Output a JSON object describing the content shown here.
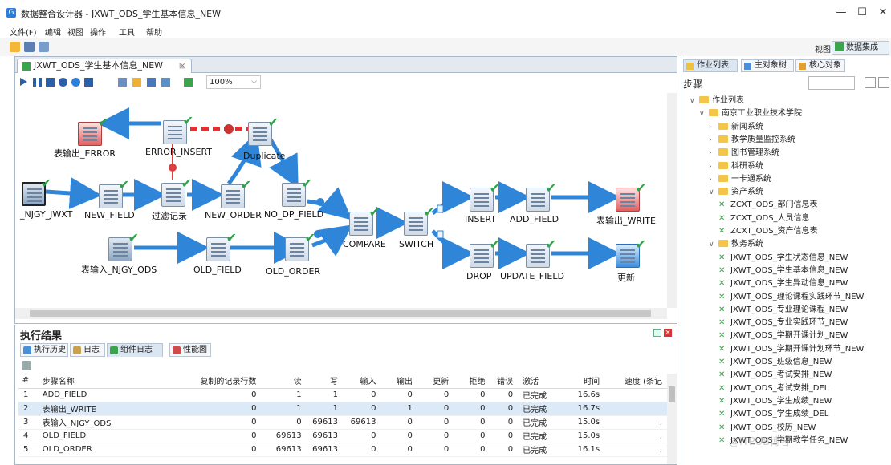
{
  "window": {
    "title": "数据整合设计器 - JXWT_ODS_学生基本信息_NEW",
    "minimize": "—",
    "maximize": "☐",
    "close": "✕"
  },
  "menu": [
    "文件(F)",
    "编辑",
    "视图",
    "操作",
    "工具",
    "帮助"
  ],
  "toolbar": {
    "view_label": "视图:",
    "view_button": "数据集成"
  },
  "editor": {
    "tab_label": "JXWT_ODS_学生基本信息_NEW",
    "tab_close": "⊠",
    "zoom": "100%",
    "nodes": {
      "error_out": "表输出_ERROR",
      "error_insert": "ERROR_INSERT",
      "duplicate": "Duplicate",
      "njgy_jwxt": "_NJGY_JWXT",
      "new_field": "NEW_FIELD",
      "filter": "过滤记录",
      "new_order": "NEW_ORDER",
      "no_dp_field": "NO_DP_FIELD",
      "compare": "COMPARE",
      "switch": "SWITCH",
      "insert": "INSERT",
      "add_field": "ADD_FIELD",
      "write_out": "表输出_WRITE",
      "njgy_ods": "表输入_NJGY_ODS",
      "old_field": "OLD_FIELD",
      "old_order": "OLD_ORDER",
      "drop": "DROP",
      "update_field": "UPDATE_FIELD",
      "update": "更新"
    }
  },
  "results": {
    "title": "执行结果",
    "tabs": [
      "执行历史",
      "日志",
      "组件日志",
      "性能图"
    ],
    "columns": [
      "#",
      "步骤名称",
      "复制的记录行数",
      "读",
      "写",
      "输入",
      "输出",
      "更新",
      "拒绝",
      "错误",
      "激活",
      "时间",
      "速度 (条记"
    ],
    "rows": [
      [
        "1",
        "ADD_FIELD",
        "0",
        "1",
        "1",
        "0",
        "0",
        "0",
        "0",
        "0",
        "已完成",
        "16.6s",
        ""
      ],
      [
        "2",
        "表输出_WRITE",
        "0",
        "1",
        "1",
        "0",
        "1",
        "0",
        "0",
        "0",
        "已完成",
        "16.7s",
        ""
      ],
      [
        "3",
        "表输入_NJGY_ODS",
        "0",
        "0",
        "69613",
        "69613",
        "0",
        "0",
        "0",
        "0",
        "已完成",
        "15.0s",
        ","
      ],
      [
        "4",
        "OLD_FIELD",
        "0",
        "69613",
        "69613",
        "0",
        "0",
        "0",
        "0",
        "0",
        "已完成",
        "15.0s",
        ","
      ],
      [
        "5",
        "OLD_ORDER",
        "0",
        "69613",
        "69613",
        "0",
        "0",
        "0",
        "0",
        "0",
        "已完成",
        "16.1s",
        ","
      ]
    ]
  },
  "right_panel": {
    "tabs": [
      "作业列表",
      "主对象树",
      "核心对象"
    ],
    "steps_label": "步骤",
    "tree": [
      {
        "level": 0,
        "kind": "folder",
        "open": true,
        "label": "作业列表"
      },
      {
        "level": 1,
        "kind": "folder",
        "open": true,
        "label": "南京工业职业技术学院"
      },
      {
        "level": 2,
        "kind": "folder",
        "open": false,
        "label": "新闻系统"
      },
      {
        "level": 2,
        "kind": "folder",
        "open": false,
        "label": "教学质量监控系统"
      },
      {
        "level": 2,
        "kind": "folder",
        "open": false,
        "label": "图书管理系统"
      },
      {
        "level": 2,
        "kind": "folder",
        "open": false,
        "label": "科研系统"
      },
      {
        "level": 2,
        "kind": "folder",
        "open": false,
        "label": "一卡通系统"
      },
      {
        "level": 2,
        "kind": "folder",
        "open": true,
        "label": "资产系统"
      },
      {
        "level": 3,
        "kind": "job",
        "label": "ZCXT_ODS_部门信息表"
      },
      {
        "level": 3,
        "kind": "job",
        "label": "ZCXT_ODS_人员信息"
      },
      {
        "level": 3,
        "kind": "job",
        "label": "ZCXT_ODS_资产信息表"
      },
      {
        "level": 2,
        "kind": "folder",
        "open": true,
        "label": "教务系统"
      },
      {
        "level": 3,
        "kind": "job",
        "label": "JXWT_ODS_学生状态信息_NEW"
      },
      {
        "level": 3,
        "kind": "job",
        "label": "JXWT_ODS_学生基本信息_NEW"
      },
      {
        "level": 3,
        "kind": "job",
        "label": "JXWT_ODS_学生异动信息_NEW"
      },
      {
        "level": 3,
        "kind": "job",
        "label": "JXWT_ODS_理论课程实践环节_NEW"
      },
      {
        "level": 3,
        "kind": "job",
        "label": "JXWT_ODS_专业理论课程_NEW"
      },
      {
        "level": 3,
        "kind": "job",
        "label": "JXWT_ODS_专业实践环节_NEW"
      },
      {
        "level": 3,
        "kind": "job",
        "label": "JXWT_ODS_学期开课计划_NEW"
      },
      {
        "level": 3,
        "kind": "job",
        "label": "JXWT_ODS_学期开课计划环节_NEW"
      },
      {
        "level": 3,
        "kind": "job",
        "label": "JXWT_ODS_班级信息_NEW"
      },
      {
        "level": 3,
        "kind": "job",
        "label": "JXWT_ODS_考试安排_NEW"
      },
      {
        "level": 3,
        "kind": "job",
        "label": "JXWT_ODS_考试安排_DEL"
      },
      {
        "level": 3,
        "kind": "job",
        "label": "JXWT_ODS_学生成绩_NEW"
      },
      {
        "level": 3,
        "kind": "job",
        "label": "JXWT_ODS_学生成绩_DEL"
      },
      {
        "level": 3,
        "kind": "job",
        "label": "JXWT_ODS_校历_NEW"
      },
      {
        "level": 3,
        "kind": "job",
        "label": "JXWT_ODS_学期教学任务_NEW"
      }
    ]
  }
}
